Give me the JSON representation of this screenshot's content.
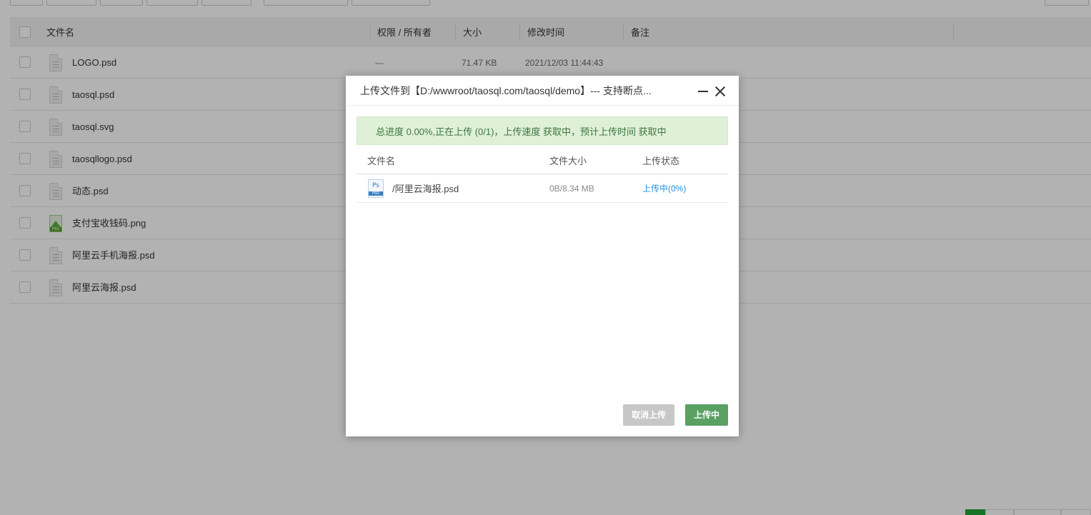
{
  "table": {
    "headers": {
      "name": "文件名",
      "permission": "权限 / 所有者",
      "size": "大小",
      "mtime": "修改时间",
      "note": "备注"
    },
    "rows": [
      {
        "name": "LOGO.psd",
        "type": "doc",
        "permission": "---",
        "size": "71.47 KB",
        "mtime": "2021/12/03 11:44:43"
      },
      {
        "name": "taosql.psd",
        "type": "doc"
      },
      {
        "name": "taosql.svg",
        "type": "doc"
      },
      {
        "name": "taosqllogo.psd",
        "type": "doc"
      },
      {
        "name": "动态.psd",
        "type": "doc"
      },
      {
        "name": "支付宝收钱码.png",
        "type": "image",
        "icon_label": "PNG"
      },
      {
        "name": "阿里云手机海报.psd",
        "type": "doc"
      },
      {
        "name": "阿里云海报.psd",
        "type": "doc"
      }
    ]
  },
  "dialog": {
    "title": "上传文件到【D:/wwwroot/taosql.com/taosql/demo】--- 支持断点...",
    "progress_text": "总进度 0.00%,正在上传 (0/1)，上传速度 获取中，预计上传时间 获取中",
    "columns": {
      "name": "文件名",
      "size": "文件大小",
      "status": "上传状态"
    },
    "files": [
      {
        "name": "/阿里云海报.psd",
        "icon_top": "Ps",
        "icon_band": "PSD",
        "size": "0B/8.34 MB",
        "status": "上传中(0%)"
      }
    ],
    "cancel_label": "取消上传",
    "upload_label": "上传中"
  },
  "colors": {
    "accent_green": "#20a53a",
    "upload_button": "#5aa063",
    "status_link": "#2a8fe0",
    "progress_bg": "#dff0d8",
    "progress_text": "#3c763d"
  }
}
